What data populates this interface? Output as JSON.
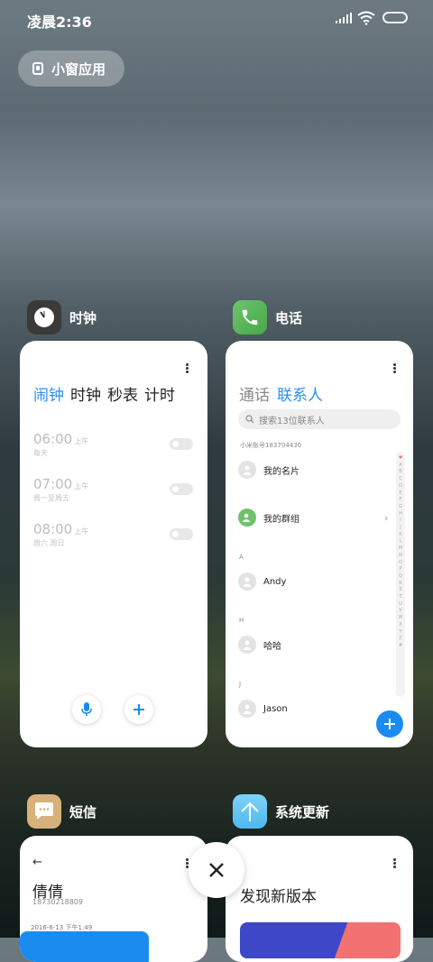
{
  "status_bar": {
    "time": "凌晨2:36"
  },
  "floating_button": {
    "label": "小窗应用"
  },
  "apps": {
    "clock": {
      "name": "时钟",
      "tabs": [
        "闹钟",
        "时钟",
        "秒表",
        "计时"
      ],
      "alarms": [
        {
          "time": "06:00",
          "ampm": "上午",
          "days": "每天",
          "enabled": false
        },
        {
          "time": "07:00",
          "ampm": "上午",
          "days": "周一至周五",
          "enabled": false
        },
        {
          "time": "08:00",
          "ampm": "上午",
          "days": "周六 周日",
          "enabled": false
        }
      ]
    },
    "phone": {
      "name": "电话",
      "tabs": [
        "通话",
        "联系人"
      ],
      "search_placeholder": "搜索13位联系人",
      "account": "小米账号183704430",
      "my_card": "我的名片",
      "my_groups": "我的群组",
      "sections": [
        {
          "letter": "A",
          "contact": "Andy"
        },
        {
          "letter": "H",
          "contact": "哈哈"
        },
        {
          "letter": "J",
          "contact": "Jason"
        }
      ],
      "index_letters": [
        "A",
        "B",
        "C",
        "D",
        "E",
        "F",
        "G",
        "H",
        "I",
        "J",
        "K",
        "L",
        "M",
        "N",
        "O",
        "P",
        "Q",
        "R",
        "S",
        "T",
        "U",
        "V",
        "W",
        "X",
        "Y",
        "Z",
        "#"
      ],
      "accent_color": "#1a8cf0"
    },
    "messages": {
      "name": "短信",
      "contact_name": "倩倩",
      "phone_number": "18730218809",
      "date": "2016-6-13 下午1:49"
    },
    "update": {
      "name": "系统更新",
      "heading": "发现新版本"
    }
  },
  "icons": {
    "clock": "clock-icon",
    "phone": "phone-icon",
    "messages": "message-icon",
    "update": "arrow-up-icon",
    "close": "close-icon"
  }
}
